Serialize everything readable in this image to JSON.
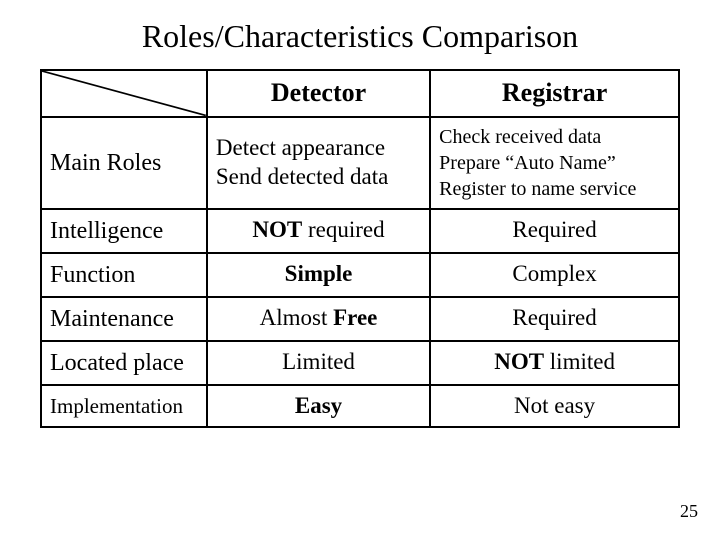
{
  "title": "Roles/Characteristics Comparison",
  "col1": "Detector",
  "col2": "Registrar",
  "rows": {
    "mainroles": {
      "label": "Main Roles",
      "det_l1": "Detect appearance",
      "det_l2": "Send detected data",
      "reg_l1": "Check received data",
      "reg_l2": "Prepare “Auto Name”",
      "reg_l3": "Register to name service"
    },
    "intelligence": {
      "label": "Intelligence",
      "det_pre": "NOT",
      "det_post": " required",
      "reg": "Required"
    },
    "function": {
      "label": "Function",
      "det": "Simple",
      "reg": "Complex"
    },
    "maintenance": {
      "label": "Maintenance",
      "det_pre": "Almost ",
      "det_post": "Free",
      "reg": "Required"
    },
    "location": {
      "label": "Located place",
      "det": "Limited",
      "reg_pre": "NOT",
      "reg_post": " limited"
    },
    "implementation": {
      "label": "Implementation",
      "det": "Easy",
      "reg": "Not easy"
    }
  },
  "pagenum": "25"
}
